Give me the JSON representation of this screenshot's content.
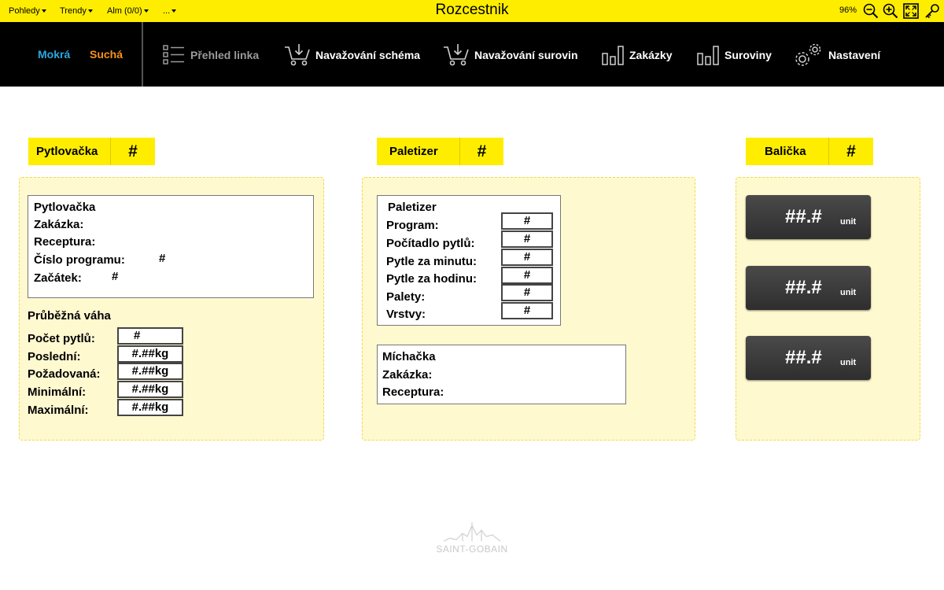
{
  "topbar": {
    "menus": [
      {
        "label": "Pohledy"
      },
      {
        "label": "Trendy"
      },
      {
        "label": "Alm (0/0)"
      },
      {
        "label": "..."
      }
    ],
    "title": "Rozcestnik",
    "zoom": "96%",
    "icons": [
      "zoom-out-icon",
      "zoom-in-icon",
      "fit-screen-icon",
      "key-icon"
    ]
  },
  "nav": {
    "modes": [
      {
        "label": "Mokrá",
        "color": "#2aa9e0"
      },
      {
        "label": "Suchá",
        "color": "#f7931e"
      }
    ],
    "items": [
      {
        "label": "Přehled linka",
        "icon": "list-icon"
      },
      {
        "label": "Navažování schéma",
        "icon": "cart-icon"
      },
      {
        "label": "Navažování surovin",
        "icon": "cart-icon"
      },
      {
        "label": "Zakázky",
        "icon": "bar-chart-icon"
      },
      {
        "label": "Suroviny",
        "icon": "bar-chart-icon"
      },
      {
        "label": "Nastavení",
        "icon": "gears-icon"
      }
    ]
  },
  "sections": {
    "pytlovacka": {
      "header": {
        "title": "Pytlovačka",
        "count": "#"
      },
      "info": {
        "title": "Pytlovačka",
        "zakazka": "Zakázka:",
        "receptura": "Receptura:",
        "cislo_programu": "Číslo programu:",
        "cislo_programu_value": "#",
        "zacatek": "Začátek:",
        "zacatek_value": "#"
      },
      "weight": {
        "title": "Průběžná váha",
        "rows": [
          {
            "label": "Počet pytlů:",
            "value": "#"
          },
          {
            "label": "Poslední:",
            "value": "#.##kg"
          },
          {
            "label": "Požadovaná:",
            "value": "#.##kg"
          },
          {
            "label": "Minimální:",
            "value": "#.##kg"
          },
          {
            "label": "Maximální:",
            "value": "#.##kg"
          }
        ]
      }
    },
    "paletizer": {
      "header": {
        "title": "Paletizer",
        "count": "#"
      },
      "info": {
        "title": "Paletizer",
        "rows": [
          {
            "label": "Program:",
            "value": "#"
          },
          {
            "label": "Počítadlo pytlů:",
            "value": "#"
          },
          {
            "label": "Pytle za minutu:",
            "value": "#"
          },
          {
            "label": "Pytle za hodinu:",
            "value": "#"
          },
          {
            "label": "Palety:",
            "value": "#"
          },
          {
            "label": "Vrstvy:",
            "value": "#"
          }
        ]
      },
      "michacka": {
        "title": "Míchačka",
        "zakazka": "Zakázka:",
        "receptura": "Receptura:"
      }
    },
    "balicka": {
      "header": {
        "title": "Balička",
        "count": "#"
      },
      "displays": [
        {
          "value": "##.#",
          "unit": "unit"
        },
        {
          "value": "##.#",
          "unit": "unit"
        },
        {
          "value": "##.#",
          "unit": "unit"
        }
      ]
    }
  },
  "footer": {
    "logo_text": "SAINT-GOBAIN"
  }
}
